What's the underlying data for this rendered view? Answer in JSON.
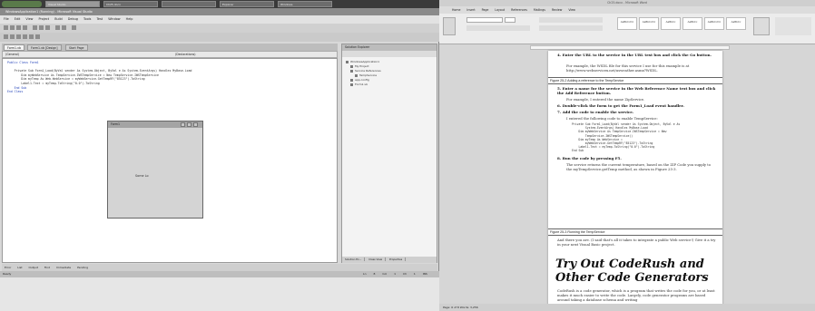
{
  "taskbar": {
    "start": "",
    "items": [
      "Visual Studio",
      "Ch25.docx",
      "",
      "Explorer",
      "Windows"
    ],
    "clock": ""
  },
  "vs": {
    "title": "WindowsApplication1 (Running) - Microsoft Visual Studio",
    "menu": "File Edit View Project Build Debug Tools Test Window Help",
    "tabs": [
      "Form1.vb",
      "Form1.vb [Design]",
      "Start Page"
    ],
    "combo_left": "(General)",
    "combo_right": "(Declarations)",
    "code_lines": [
      "Public Class Form1",
      "",
      "    Private Sub Form1_Load(ByVal sender As System.Object, ByVal e As System.EventArgs) Handles MyBase.Load",
      "        Dim myWebService As TempService.IWSTempService = New TempService.IWSTempService",
      "        Dim myTemp As Web.WebService = myWebService.GetTempRF(\"85123\").ToString",
      "        Label1.Text = myTemp.ToString(\"0.0\").ToString",
      "    End Sub",
      "End Class"
    ],
    "form_title": "Form1",
    "form_label": "Some Lo",
    "solution_title": "Solution Explorer",
    "tree": [
      "WindowsApplication1",
      "My Project",
      "Service References",
      "TempService",
      "app.config",
      "Form1.vb"
    ],
    "solution_tabs": [
      "Solution Ex...",
      "Class View",
      "Properties"
    ],
    "bottom_tabs": "Error List  Output  Find  Immediate  Pending",
    "status": "Ready",
    "status_pos": "Ln 8   Col 1   Ch 1   INS"
  },
  "word": {
    "title": "Ch25.docx - Microsoft Word",
    "tabs": "Home Insert Page Layout References Mailings Review View",
    "styles": [
      "AaBbCcDc",
      "AaBbCcDc",
      "AaBbCc",
      "AaBbCc",
      "AaBbCcDc",
      "AaBbCc"
    ],
    "step4": "4.  Enter the URL to the service in the URL text box and click the Go button.",
    "para4": "For example, the WSDL file for this service I use for this example is at http://www.webservicex.net/usweather.asmx?WSDL.",
    "fig2": "Figure 25-2  Adding a reference to the TempService",
    "step5": "5.  Enter a name for the service in the Web Reference Name text box and click the Add Reference button.",
    "para5": "For example, I entered the name ZipService.",
    "step6": "6.  Double-click the form to get the Form1_Load event handler.",
    "step7": "7.  Add the code to enable the service.",
    "para7": "I entered the following code to enable TempService:",
    "code": [
      "Private Sub Form1_Load(ByVal sender As System.Object, ByVal e As",
      "        System.EventArgs) Handles MyBase.Load",
      "    Dim myWebService As TempService.IWSTempService = New",
      "        TempService.IWSTempService()",
      "    Dim myTemp As WebService =",
      "        myWebService.GetTempRF(\"85123\").ToString",
      "    Label1.Text = myTemp.ToString(\"0.0\").ToString",
      "End Sub"
    ],
    "step8": "8.  Run the code by pressing F5.",
    "para8": "The service returns the current temperature, based on the ZIP Code you supply to the myTempService.getTemp method, as shown in Figure 25-3.",
    "fig3": "Figure 25-3  Running the TempService",
    "para9": "And there you are. (I said that's all it takes to integrate a public Web service!) Give it a try in your next Visual Basic project.",
    "heading": "Try Out CodeRush and Other Code Generators",
    "para10": "CodeRush is a code generator, which is a program that writes the code for you, or at least makes it much easier to write the code. Largely, code generator programs are based around taking a database schema and writing",
    "status": "Page: 6 of 8   Words: 3,256"
  }
}
